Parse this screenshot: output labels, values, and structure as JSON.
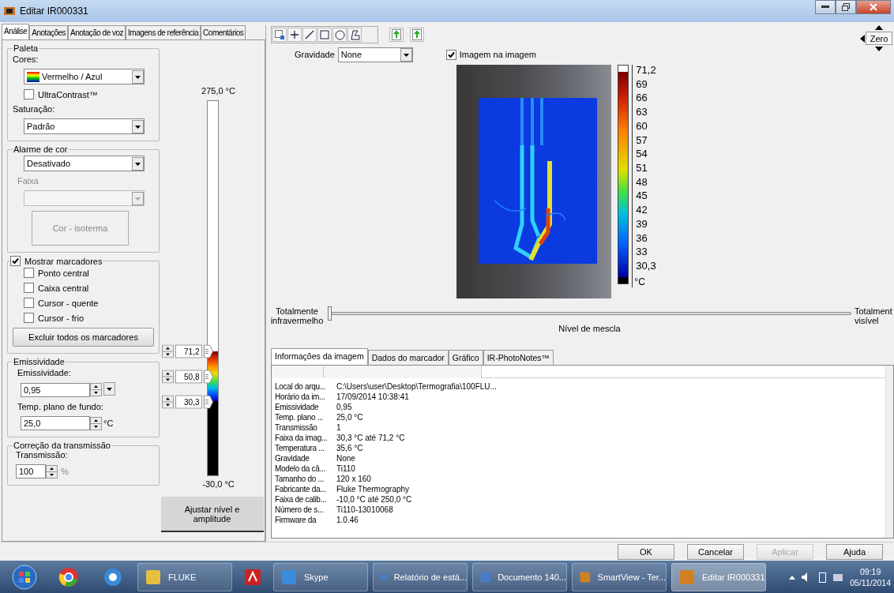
{
  "window": {
    "title": "Editar IR000331"
  },
  "left_tabs": [
    {
      "label": "Análise",
      "selected": true
    },
    {
      "label": "Anotações",
      "selected": false
    },
    {
      "label": "Anotação de voz",
      "selected": false
    },
    {
      "label": "Imagens de referência",
      "selected": false
    },
    {
      "label": "Comentários",
      "selected": false
    }
  ],
  "palette": {
    "legend": "Paleta",
    "colors_label": "Cores:",
    "colors_value": "Vermelho / Azul",
    "ultracontrast": {
      "label": "UltraContrast™",
      "checked": false
    },
    "saturation_label": "Saturação:",
    "saturation_value": "Padrão"
  },
  "color_alarm": {
    "legend": "Alarme de cor",
    "value": "Desativado",
    "range_label": "Faixa",
    "range_disabled": true,
    "isotherm_button": "Cor - isoterma",
    "isotherm_disabled": true
  },
  "markers": {
    "label": "Mostrar marcadores",
    "checked": true,
    "options": [
      {
        "label": "Ponto central",
        "checked": false
      },
      {
        "label": "Caixa central",
        "checked": false
      },
      {
        "label": "Cursor - quente",
        "checked": false
      },
      {
        "label": "Cursor - frio",
        "checked": false
      }
    ],
    "delete_button": "Excluir todos os marcadores"
  },
  "emissivity": {
    "legend": "Emissividade",
    "emissivity_label": "Emissividade:",
    "emissivity_value": "0,95",
    "background_label": "Temp. plano de fundo:",
    "background_value": "25,0",
    "background_unit": "°C"
  },
  "transmission": {
    "legend": "Correção da transmissão",
    "label": "Transmissão:",
    "value": "100",
    "unit": "%"
  },
  "scale": {
    "max": "275,0 °C",
    "min": "-30,0 °C",
    "handles": [
      {
        "value": "71,2",
        "level": 0.332
      },
      {
        "value": "50,8",
        "level": 0.265
      },
      {
        "value": "30,3",
        "level": 0.198
      }
    ],
    "adjust_button": "Ajustar nível e amplitude"
  },
  "gravity": {
    "label": "Gravidade",
    "value": "None"
  },
  "picture_in_picture": {
    "label": "Imagem na imagem",
    "checked": true
  },
  "zero_button": "Zero",
  "color_bar": {
    "ticks": [
      "71,2",
      "69",
      "66",
      "63",
      "60",
      "57",
      "54",
      "51",
      "48",
      "45",
      "42",
      "39",
      "36",
      "33",
      "30,3"
    ],
    "unit": "°C"
  },
  "blend": {
    "left_label": "Totalmente infravermelho",
    "center_label": "Nível de mescla",
    "right_label": "Totalment visível",
    "level": 0
  },
  "info_tabs": [
    {
      "label": "Informações da imagem",
      "selected": true
    },
    {
      "label": "Dados do marcador",
      "selected": false
    },
    {
      "label": "Gráfico",
      "selected": false
    },
    {
      "label": "IR-PhotoNotes™",
      "selected": false
    }
  ],
  "info_rows": [
    {
      "name": "Local do arqu...",
      "value": "C:\\Users\\user\\Desktop\\Termografia\\100FLU..."
    },
    {
      "name": "Horário da im...",
      "value": "17/09/2014 10:38:41"
    },
    {
      "name": "Emissividade",
      "value": "0,95"
    },
    {
      "name": "Temp. plano ...",
      "value": "25,0 °C"
    },
    {
      "name": "Transmissão",
      "value": "1"
    },
    {
      "name": "Faixa da imag...",
      "value": "30,3 °C até 71,2 °C"
    },
    {
      "name": "Temperatura ...",
      "value": "35,6 °C"
    },
    {
      "name": "Gravidade",
      "value": "None"
    },
    {
      "name": "Modelo da câ...",
      "value": "Ti110"
    },
    {
      "name": "Tamanho do ...",
      "value": "120 x 160"
    },
    {
      "name": "Fabricante da...",
      "value": "Fluke Thermography"
    },
    {
      "name": "Faixa de calib...",
      "value": "-10,0 °C até 250,0 °C"
    },
    {
      "name": "Número de s...",
      "value": "Ti110-13010068"
    },
    {
      "name": "Firmware da",
      "value": "1.0.46"
    }
  ],
  "dialog_buttons": [
    {
      "label": "OK",
      "disabled": false
    },
    {
      "label": "Cancelar",
      "disabled": false
    },
    {
      "label": "Aplicar",
      "disabled": true
    },
    {
      "label": "Ajuda",
      "disabled": false
    }
  ],
  "taskbar": {
    "items": [
      {
        "label": "FLUKE",
        "selected": false
      },
      {
        "label": "Skype",
        "selected": false
      },
      {
        "label": "Relatório de está...",
        "selected": false
      },
      {
        "label": "Documento 140...",
        "selected": false
      },
      {
        "label": "SmartView - Ter...",
        "selected": false
      },
      {
        "label": "Editar IR000331",
        "selected": true
      }
    ],
    "time": "09:19",
    "date": "05/11/2014"
  }
}
